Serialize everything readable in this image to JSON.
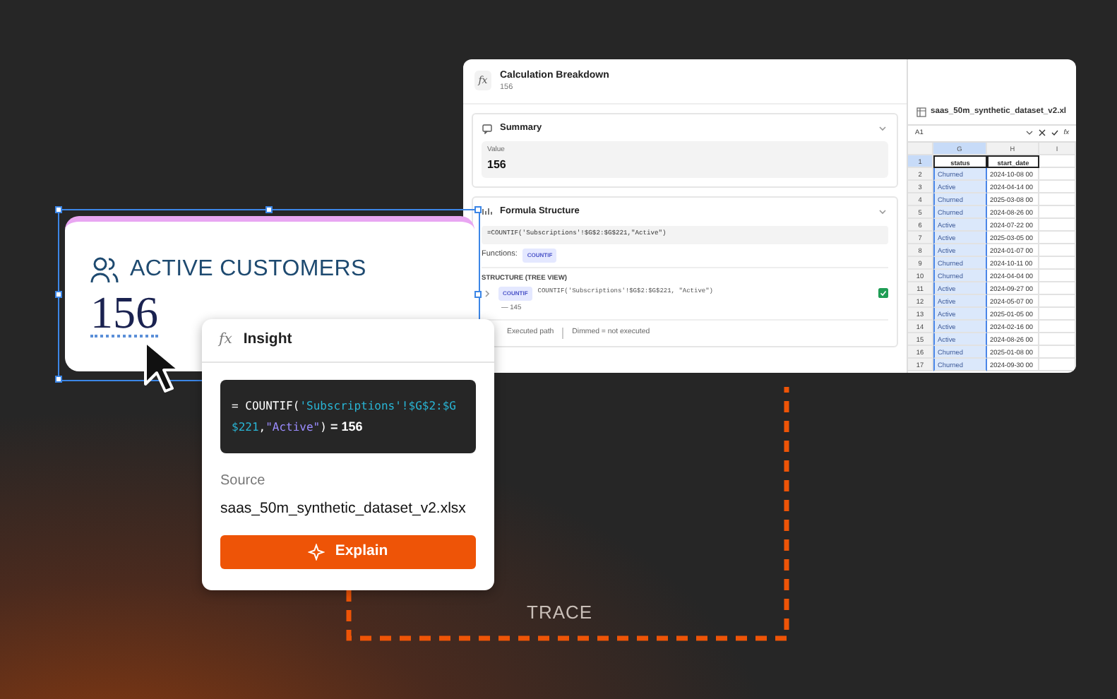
{
  "breakdown": {
    "icon": "fx",
    "title": "Calculation Breakdown",
    "subtitle": "156",
    "summary": {
      "title": "Summary",
      "expanded": true,
      "value_label": "Value",
      "value": "156"
    },
    "formula_structure": {
      "title": "Formula Structure",
      "expanded": true,
      "formula": "=COUNTIF('Subscriptions'!$G$2:$G$221,\"Active\")",
      "functions_label": "Functions:",
      "functions": [
        "COUNTIF"
      ],
      "tree_title": "STRUCTURE (TREE VIEW)",
      "tree": [
        {
          "function": "COUNTIF",
          "text": "COUNTIF('Subscriptions'!$G$2:$G$221, \"Active\")",
          "executed": true,
          "expanded": false,
          "children": [
            {
              "text": "— 145"
            }
          ]
        }
      ],
      "legend": [
        "Executed path",
        "Dimmed = not executed"
      ]
    }
  },
  "spreadsheet": {
    "title": "saas_50m_synthetic_dataset_v2.xl",
    "cell_ref": "A1",
    "formula_icon": "fx",
    "columns": [
      {
        "letter": "G",
        "selected": true
      },
      {
        "letter": "H",
        "selected": false
      },
      {
        "letter": "I",
        "selected": false
      }
    ],
    "header_row": {
      "number": "1",
      "cells": [
        "status",
        "start_date"
      ]
    },
    "rows": [
      {
        "number": "2",
        "cells": [
          "Churned",
          "2024-10-08 00"
        ]
      },
      {
        "number": "3",
        "cells": [
          "Active",
          "2024-04-14 00"
        ]
      },
      {
        "number": "4",
        "cells": [
          "Churned",
          "2025-03-08 00"
        ]
      },
      {
        "number": "5",
        "cells": [
          "Churned",
          "2024-08-26 00"
        ]
      },
      {
        "number": "6",
        "cells": [
          "Active",
          "2024-07-22 00"
        ]
      },
      {
        "number": "7",
        "cells": [
          "Active",
          "2025-03-05 00"
        ]
      },
      {
        "number": "8",
        "cells": [
          "Active",
          "2024-01-07 00"
        ]
      },
      {
        "number": "9",
        "cells": [
          "Churned",
          "2024-10-11 00"
        ]
      },
      {
        "number": "10",
        "cells": [
          "Churned",
          "2024-04-04 00"
        ]
      },
      {
        "number": "11",
        "cells": [
          "Active",
          "2024-09-27 00"
        ]
      },
      {
        "number": "12",
        "cells": [
          "Active",
          "2024-05-07 00"
        ]
      },
      {
        "number": "13",
        "cells": [
          "Active",
          "2025-01-05 00"
        ]
      },
      {
        "number": "14",
        "cells": [
          "Active",
          "2024-02-16 00"
        ]
      },
      {
        "number": "15",
        "cells": [
          "Active",
          "2024-08-26 00"
        ]
      },
      {
        "number": "16",
        "cells": [
          "Churned",
          "2025-01-08 00"
        ]
      },
      {
        "number": "17",
        "cells": [
          "Churned",
          "2024-09-30 00"
        ]
      }
    ]
  },
  "kpi_card": {
    "title": "ACTIVE CUSTOMERS",
    "value": "156",
    "selected": true
  },
  "insight": {
    "icon": "fx",
    "title": "Insight",
    "formula": [
      {
        "kind": "punct",
        "text": "="
      },
      {
        "kind": "fn",
        "text": " COUNTIF("
      },
      {
        "kind": "ref",
        "text": "'Subscriptions'!$G$2:$G$221"
      },
      {
        "kind": "punct",
        "text": ","
      },
      {
        "kind": "str",
        "text": "\"Active\""
      },
      {
        "kind": "punct",
        "text": ")"
      },
      {
        "kind": "result",
        "text": " = 156"
      }
    ],
    "source_label": "Source",
    "source": "saas_50m_synthetic_dataset_v2.xlsx",
    "button": "Explain"
  },
  "trace_label": "TRACE"
}
